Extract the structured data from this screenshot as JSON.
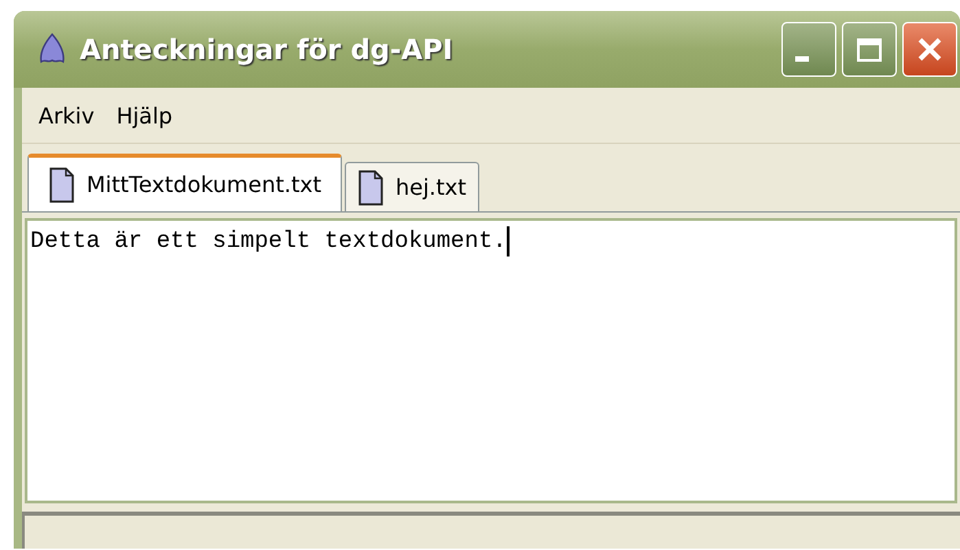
{
  "window": {
    "title": "Anteckningar för dg-API"
  },
  "menu": [
    "Arkiv",
    "Hjälp"
  ],
  "tabs": [
    {
      "label": "MittTextdokument.txt",
      "selected": true
    },
    {
      "label": "hej.txt",
      "selected": false
    }
  ],
  "editor": {
    "value": "Detta är ett simpelt textdokument."
  }
}
